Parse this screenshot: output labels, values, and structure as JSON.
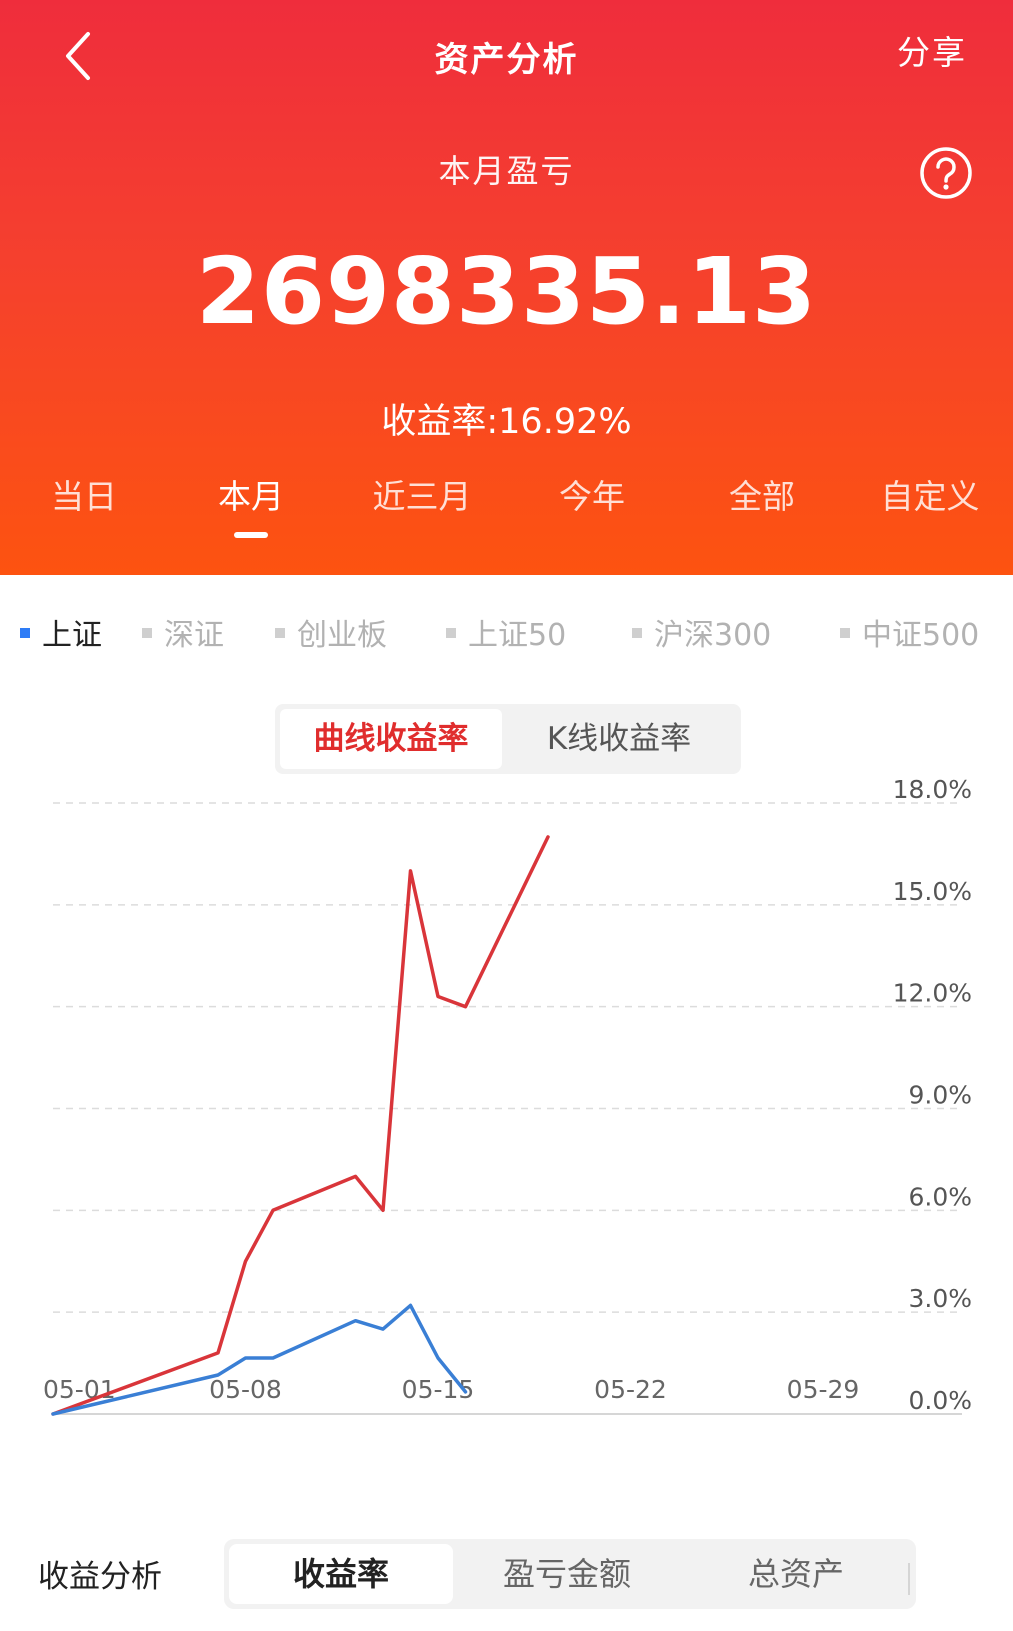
{
  "header": {
    "title": "资产分析",
    "share_label": "分享",
    "subtitle": "本月盈亏",
    "amount": "2698335.13",
    "rate_label": "收益率:16.92%"
  },
  "period_tabs": [
    {
      "label": "当日",
      "active": false
    },
    {
      "label": "本月",
      "active": true
    },
    {
      "label": "近三月",
      "active": false
    },
    {
      "label": "今年",
      "active": false
    },
    {
      "label": "全部",
      "active": false
    },
    {
      "label": "自定义",
      "active": false
    }
  ],
  "indices": [
    {
      "label": "上证",
      "active": true
    },
    {
      "label": "深证",
      "active": false
    },
    {
      "label": "创业板",
      "active": false
    },
    {
      "label": "上证50",
      "active": false
    },
    {
      "label": "沪深300",
      "active": false
    },
    {
      "label": "中证500",
      "active": false
    }
  ],
  "chart_toggle": {
    "curve_label": "曲线收益率",
    "kline_label": "K线收益率",
    "active": "curve"
  },
  "bottom": {
    "label": "收益分析",
    "tabs": [
      {
        "label": "收益率",
        "active": true
      },
      {
        "label": "盈亏金额",
        "active": false
      },
      {
        "label": "总资产",
        "active": false
      }
    ]
  },
  "colors": {
    "header_top": "#ef2d3c",
    "header_bottom": "#fd5310",
    "portfolio_line": "#d9353a",
    "index_line": "#3a7fd5",
    "active_index": "#2e7cf6"
  },
  "chart_data": {
    "type": "line",
    "x_ticks": [
      "05-01",
      "05-08",
      "05-15",
      "05-22",
      "05-29"
    ],
    "y_ticks": [
      "18.0%",
      "15.0%",
      "12.0%",
      "9.0%",
      "6.0%",
      "3.0%",
      "0.0%"
    ],
    "ylim": [
      0,
      18
    ],
    "xlim": [
      "05-01",
      "05-31"
    ],
    "grid": true,
    "series": [
      {
        "color": "#d9353a",
        "points": [
          [
            "05-01",
            0.0
          ],
          [
            "05-07",
            1.8
          ],
          [
            "05-08",
            4.5
          ],
          [
            "05-09",
            6.0
          ],
          [
            "05-12",
            7.0
          ],
          [
            "05-13",
            6.0
          ],
          [
            "05-14",
            16.0
          ],
          [
            "05-15",
            12.3
          ],
          [
            "05-16",
            12.0
          ],
          [
            "05-19",
            17.0
          ]
        ]
      },
      {
        "color": "#3a7fd5",
        "points": [
          [
            "05-01",
            0.0
          ],
          [
            "05-07",
            1.15
          ],
          [
            "05-08",
            1.65
          ],
          [
            "05-09",
            1.65
          ],
          [
            "05-12",
            2.75
          ],
          [
            "05-13",
            2.5
          ],
          [
            "05-14",
            3.2
          ],
          [
            "05-15",
            1.65
          ],
          [
            "05-16",
            0.65
          ]
        ]
      }
    ]
  }
}
